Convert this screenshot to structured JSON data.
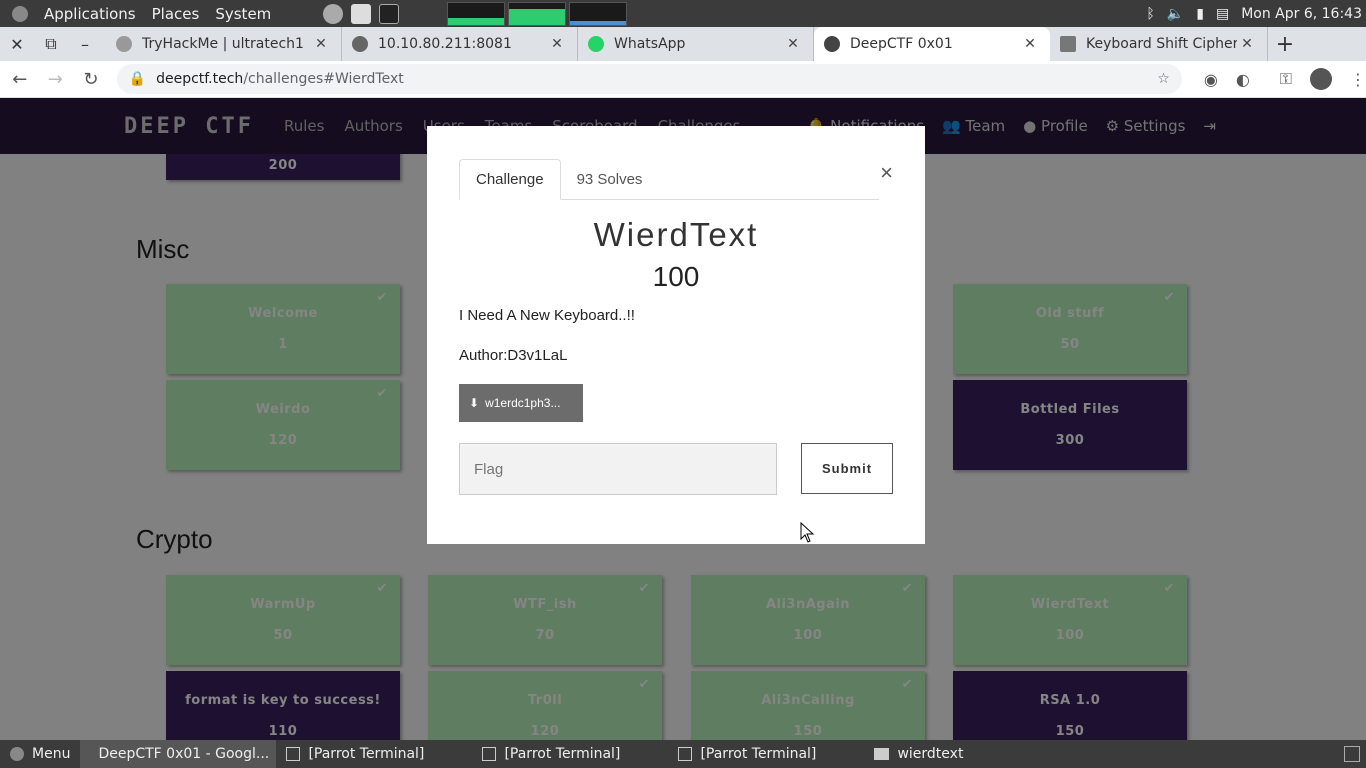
{
  "system_panel": {
    "menus": [
      "Applications",
      "Places",
      "System"
    ],
    "clock": "Mon Apr  6, 16:43"
  },
  "browser": {
    "tabs": [
      {
        "title": "TryHackMe | ultratech1",
        "icon": "cloud-icon"
      },
      {
        "title": "10.10.80.211:8081",
        "icon": "globe-icon"
      },
      {
        "title": "WhatsApp",
        "icon": "whatsapp-icon"
      },
      {
        "title": "DeepCTF 0x01",
        "icon": "deepctf-icon",
        "active": true
      },
      {
        "title": "Keyboard Shift Cipher - S",
        "icon": "cipher-icon"
      }
    ],
    "url_domain": "deepctf.tech",
    "url_path": "/challenges#WierdText"
  },
  "site_nav": {
    "logo": "DEEP CTF",
    "links": [
      "Rules",
      "Authors",
      "Users",
      "Teams",
      "Scoreboard",
      "Challenges"
    ],
    "right_links": [
      "Notifications",
      "Team",
      "Profile",
      "Settings"
    ]
  },
  "sections": [
    {
      "title": "Misc",
      "cards": [
        {
          "name": "Welcome",
          "value": "1",
          "solved": true
        },
        {
          "name": "Old stuff",
          "value": "50",
          "solved": true
        },
        {
          "name": "Weirdo",
          "value": "120",
          "solved": true
        },
        {
          "name": "Bottled Files",
          "value": "300",
          "solved": false
        }
      ]
    },
    {
      "title": "Crypto",
      "cards": [
        {
          "name": "WarmUp",
          "value": "50",
          "solved": true
        },
        {
          "name": "WTF_ish",
          "value": "70",
          "solved": true
        },
        {
          "name": "Ali3nAgain",
          "value": "100",
          "solved": true
        },
        {
          "name": "WierdText",
          "value": "100",
          "solved": true
        },
        {
          "name": "format is key to success!",
          "value": "110",
          "solved": false
        },
        {
          "name": "Tr0ll",
          "value": "120",
          "solved": true
        },
        {
          "name": "Ali3nCalling",
          "value": "150",
          "solved": true
        },
        {
          "name": "RSA 1.0",
          "value": "150",
          "solved": false
        }
      ]
    }
  ],
  "top_card": {
    "value": "200"
  },
  "modal": {
    "tab_challenge": "Challenge",
    "tab_solves": "93 Solves",
    "close": "×",
    "title": "WierdText",
    "value": "100",
    "description": "I Need A New Keyboard..!!",
    "author": "Author:D3v1LaL",
    "file": "w1erdc1ph3...",
    "flag_placeholder": "Flag",
    "submit": "Submit"
  },
  "taskbar": {
    "menu": "Menu",
    "items": [
      "DeepCTF 0x01 - Googl...",
      "[Parrot Terminal]",
      "[Parrot Terminal]",
      "[Parrot Terminal]",
      "wierdtext"
    ]
  },
  "colors": {
    "site_nav_bg": "#29173f",
    "solved_card": "#b7f0b8",
    "unsolved_card": "#3b1f5e"
  }
}
